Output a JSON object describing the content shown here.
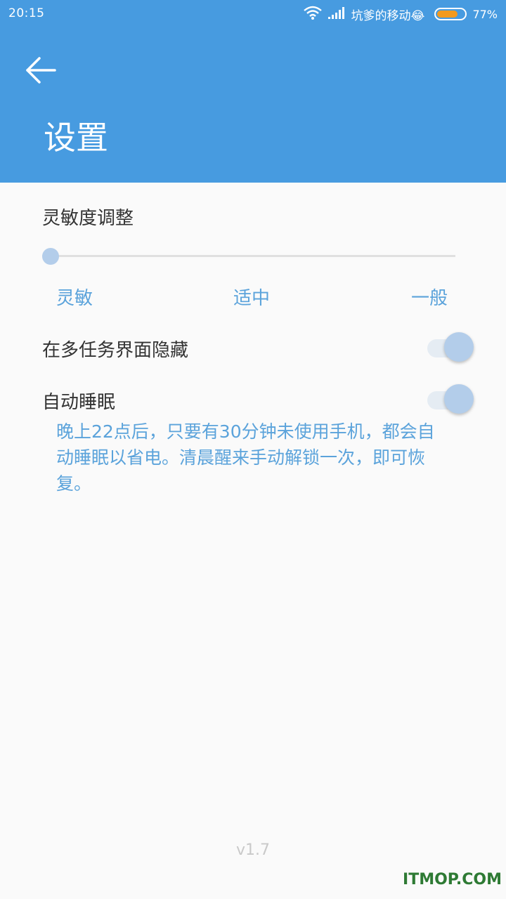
{
  "status_bar": {
    "time": "20:15",
    "carrier": "坑爹的移动😂",
    "battery_percent_text": "77%",
    "battery_level": 0.77,
    "battery_color": "#f39a1e",
    "icons": [
      "wifi-icon",
      "signal-icon",
      "battery-icon"
    ]
  },
  "header": {
    "back_icon": "arrow-left-icon",
    "title": "设置",
    "bg_color": "#479be0"
  },
  "sensitivity": {
    "label": "灵敏度调整",
    "slider_value": 0,
    "levels": [
      "灵敏",
      "适中",
      "一般"
    ]
  },
  "settings": [
    {
      "label": "在多任务界面隐藏",
      "enabled": true
    },
    {
      "label": "自动睡眠",
      "enabled": true
    }
  ],
  "sleep_description": "晚上22点后，只要有30分钟未使用手机，都会自动睡眠以省电。清晨醒来手动解锁一次，即可恢复。",
  "version": "v1.7",
  "watermark": "ITMOP.COM"
}
